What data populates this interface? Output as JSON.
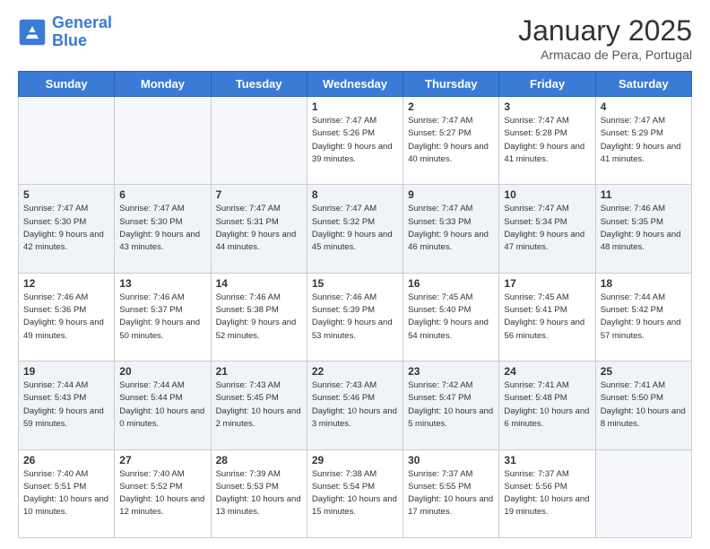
{
  "header": {
    "logo_line1": "General",
    "logo_line2": "Blue",
    "month": "January 2025",
    "location": "Armacao de Pera, Portugal"
  },
  "days_of_week": [
    "Sunday",
    "Monday",
    "Tuesday",
    "Wednesday",
    "Thursday",
    "Friday",
    "Saturday"
  ],
  "weeks": [
    [
      {
        "day": "",
        "info": ""
      },
      {
        "day": "",
        "info": ""
      },
      {
        "day": "",
        "info": ""
      },
      {
        "day": "1",
        "info": "Sunrise: 7:47 AM\nSunset: 5:26 PM\nDaylight: 9 hours and 39 minutes."
      },
      {
        "day": "2",
        "info": "Sunrise: 7:47 AM\nSunset: 5:27 PM\nDaylight: 9 hours and 40 minutes."
      },
      {
        "day": "3",
        "info": "Sunrise: 7:47 AM\nSunset: 5:28 PM\nDaylight: 9 hours and 41 minutes."
      },
      {
        "day": "4",
        "info": "Sunrise: 7:47 AM\nSunset: 5:29 PM\nDaylight: 9 hours and 41 minutes."
      }
    ],
    [
      {
        "day": "5",
        "info": "Sunrise: 7:47 AM\nSunset: 5:30 PM\nDaylight: 9 hours and 42 minutes."
      },
      {
        "day": "6",
        "info": "Sunrise: 7:47 AM\nSunset: 5:30 PM\nDaylight: 9 hours and 43 minutes."
      },
      {
        "day": "7",
        "info": "Sunrise: 7:47 AM\nSunset: 5:31 PM\nDaylight: 9 hours and 44 minutes."
      },
      {
        "day": "8",
        "info": "Sunrise: 7:47 AM\nSunset: 5:32 PM\nDaylight: 9 hours and 45 minutes."
      },
      {
        "day": "9",
        "info": "Sunrise: 7:47 AM\nSunset: 5:33 PM\nDaylight: 9 hours and 46 minutes."
      },
      {
        "day": "10",
        "info": "Sunrise: 7:47 AM\nSunset: 5:34 PM\nDaylight: 9 hours and 47 minutes."
      },
      {
        "day": "11",
        "info": "Sunrise: 7:46 AM\nSunset: 5:35 PM\nDaylight: 9 hours and 48 minutes."
      }
    ],
    [
      {
        "day": "12",
        "info": "Sunrise: 7:46 AM\nSunset: 5:36 PM\nDaylight: 9 hours and 49 minutes."
      },
      {
        "day": "13",
        "info": "Sunrise: 7:46 AM\nSunset: 5:37 PM\nDaylight: 9 hours and 50 minutes."
      },
      {
        "day": "14",
        "info": "Sunrise: 7:46 AM\nSunset: 5:38 PM\nDaylight: 9 hours and 52 minutes."
      },
      {
        "day": "15",
        "info": "Sunrise: 7:46 AM\nSunset: 5:39 PM\nDaylight: 9 hours and 53 minutes."
      },
      {
        "day": "16",
        "info": "Sunrise: 7:45 AM\nSunset: 5:40 PM\nDaylight: 9 hours and 54 minutes."
      },
      {
        "day": "17",
        "info": "Sunrise: 7:45 AM\nSunset: 5:41 PM\nDaylight: 9 hours and 56 minutes."
      },
      {
        "day": "18",
        "info": "Sunrise: 7:44 AM\nSunset: 5:42 PM\nDaylight: 9 hours and 57 minutes."
      }
    ],
    [
      {
        "day": "19",
        "info": "Sunrise: 7:44 AM\nSunset: 5:43 PM\nDaylight: 9 hours and 59 minutes."
      },
      {
        "day": "20",
        "info": "Sunrise: 7:44 AM\nSunset: 5:44 PM\nDaylight: 10 hours and 0 minutes."
      },
      {
        "day": "21",
        "info": "Sunrise: 7:43 AM\nSunset: 5:45 PM\nDaylight: 10 hours and 2 minutes."
      },
      {
        "day": "22",
        "info": "Sunrise: 7:43 AM\nSunset: 5:46 PM\nDaylight: 10 hours and 3 minutes."
      },
      {
        "day": "23",
        "info": "Sunrise: 7:42 AM\nSunset: 5:47 PM\nDaylight: 10 hours and 5 minutes."
      },
      {
        "day": "24",
        "info": "Sunrise: 7:41 AM\nSunset: 5:48 PM\nDaylight: 10 hours and 6 minutes."
      },
      {
        "day": "25",
        "info": "Sunrise: 7:41 AM\nSunset: 5:50 PM\nDaylight: 10 hours and 8 minutes."
      }
    ],
    [
      {
        "day": "26",
        "info": "Sunrise: 7:40 AM\nSunset: 5:51 PM\nDaylight: 10 hours and 10 minutes."
      },
      {
        "day": "27",
        "info": "Sunrise: 7:40 AM\nSunset: 5:52 PM\nDaylight: 10 hours and 12 minutes."
      },
      {
        "day": "28",
        "info": "Sunrise: 7:39 AM\nSunset: 5:53 PM\nDaylight: 10 hours and 13 minutes."
      },
      {
        "day": "29",
        "info": "Sunrise: 7:38 AM\nSunset: 5:54 PM\nDaylight: 10 hours and 15 minutes."
      },
      {
        "day": "30",
        "info": "Sunrise: 7:37 AM\nSunset: 5:55 PM\nDaylight: 10 hours and 17 minutes."
      },
      {
        "day": "31",
        "info": "Sunrise: 7:37 AM\nSunset: 5:56 PM\nDaylight: 10 hours and 19 minutes."
      },
      {
        "day": "",
        "info": ""
      }
    ]
  ]
}
